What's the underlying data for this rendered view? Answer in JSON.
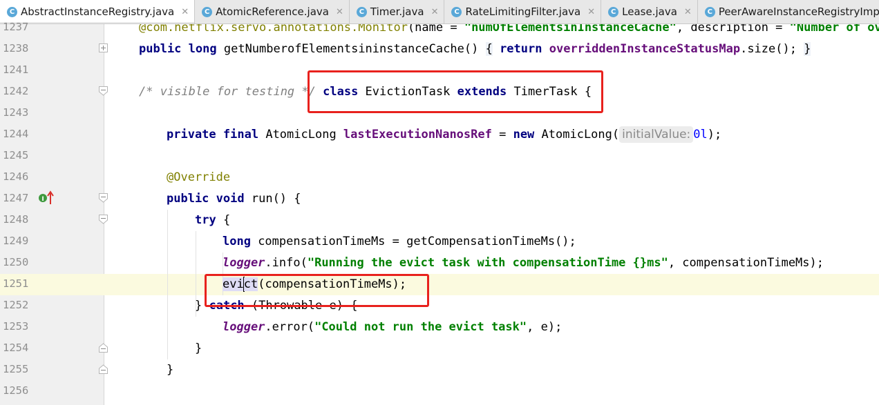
{
  "tabs": [
    {
      "label": "AbstractInstanceRegistry.java",
      "active": true,
      "has_close": true,
      "icon": "class-icon"
    },
    {
      "label": "AtomicReference.java",
      "active": false,
      "has_close": true,
      "icon": "class-icon"
    },
    {
      "label": "Timer.java",
      "active": false,
      "has_close": true,
      "icon": "class-icon"
    },
    {
      "label": "RateLimitingFilter.java",
      "active": false,
      "has_close": true,
      "icon": "class-icon"
    },
    {
      "label": "Lease.java",
      "active": false,
      "has_close": true,
      "icon": "class-icon"
    },
    {
      "label": "PeerAwareInstanceRegistryImpl.java",
      "active": false,
      "has_close": false,
      "icon": "class-icon"
    }
  ],
  "tab_icon_glyph": "C",
  "tab_close_glyph": "✕",
  "line_numbers": [
    "1237",
    "1238",
    "1241",
    "1242",
    "1243",
    "1244",
    "1245",
    "1246",
    "1247",
    "1248",
    "1249",
    "1250",
    "1251",
    "1252",
    "1253",
    "1254",
    "1255",
    "1256"
  ],
  "current_line": "1251",
  "code": {
    "l1237": {
      "t1": "@com.netflix.servo.annotations.",
      "t2": "Monitor",
      "t3": "(name = ",
      "t4": "\"numOfElementsinInstanceCache\"",
      "t5": ", description = ",
      "t6": "\"Number of over"
    },
    "l1238": {
      "t1": "public",
      "t2": " ",
      "t3": "long",
      "t4": " getNumberofElementsininstanceCache() ",
      "t5": "{",
      "t6": " ",
      "t7": "return",
      "t8": " ",
      "t9": "overriddenInstanceStatusMap",
      "t10": ".size(); ",
      "t11": "}"
    },
    "l1242": {
      "t1": "/* visible for testing */",
      "t2": " ",
      "t3": "class",
      "t4": " EvictionTask ",
      "t5": "extends",
      "t6": " TimerTask {"
    },
    "l1244": {
      "t1": "private",
      "t2": " ",
      "t3": "final",
      "t4": " AtomicLong ",
      "t5": "lastExecutionNanosRef",
      "t6": " = ",
      "t7": "new",
      "t8": " AtomicLong(",
      "t9": "initialValue:",
      "t10": "0l",
      "t11": ");"
    },
    "l1246": {
      "t1": "@Override"
    },
    "l1247": {
      "t1": "public",
      "t2": " ",
      "t3": "void",
      "t4": " run() {"
    },
    "l1248": {
      "t1": "try",
      "t2": " {"
    },
    "l1249": {
      "t1": "long",
      "t2": " compensationTimeMs = getCompensationTimeMs();"
    },
    "l1250": {
      "t1": "logger",
      "t2": ".info(",
      "t3": "\"Running the evict task with compensationTime {}ms\"",
      "t4": ", compensationTimeMs);"
    },
    "l1251": {
      "t1": "evi",
      "t2": "ct",
      "t3": "(compensationTimeMs);"
    },
    "l1252": {
      "t1": "} ",
      "t2": "catch",
      "t3": " (Throwable e) {"
    },
    "l1253": {
      "t1": "logger",
      "t2": ".error(",
      "t3": "\"Could not run the evict task\"",
      "t4": ", e);"
    },
    "l1254": {
      "t1": "}"
    },
    "l1255": {
      "t1": "}"
    }
  },
  "colors": {
    "keyword": "#000080",
    "field": "#660e7a",
    "string": "#008000",
    "comment": "#808080",
    "annotation": "#808000",
    "number": "#0000ff",
    "highlight_box": "#e8211d",
    "current_line_bg": "#fbfadf",
    "gutter_bg": "#f0f0f0"
  },
  "gutter_markers": {
    "implements_icon": "implementing-method-icon",
    "implements_letter": "I"
  }
}
